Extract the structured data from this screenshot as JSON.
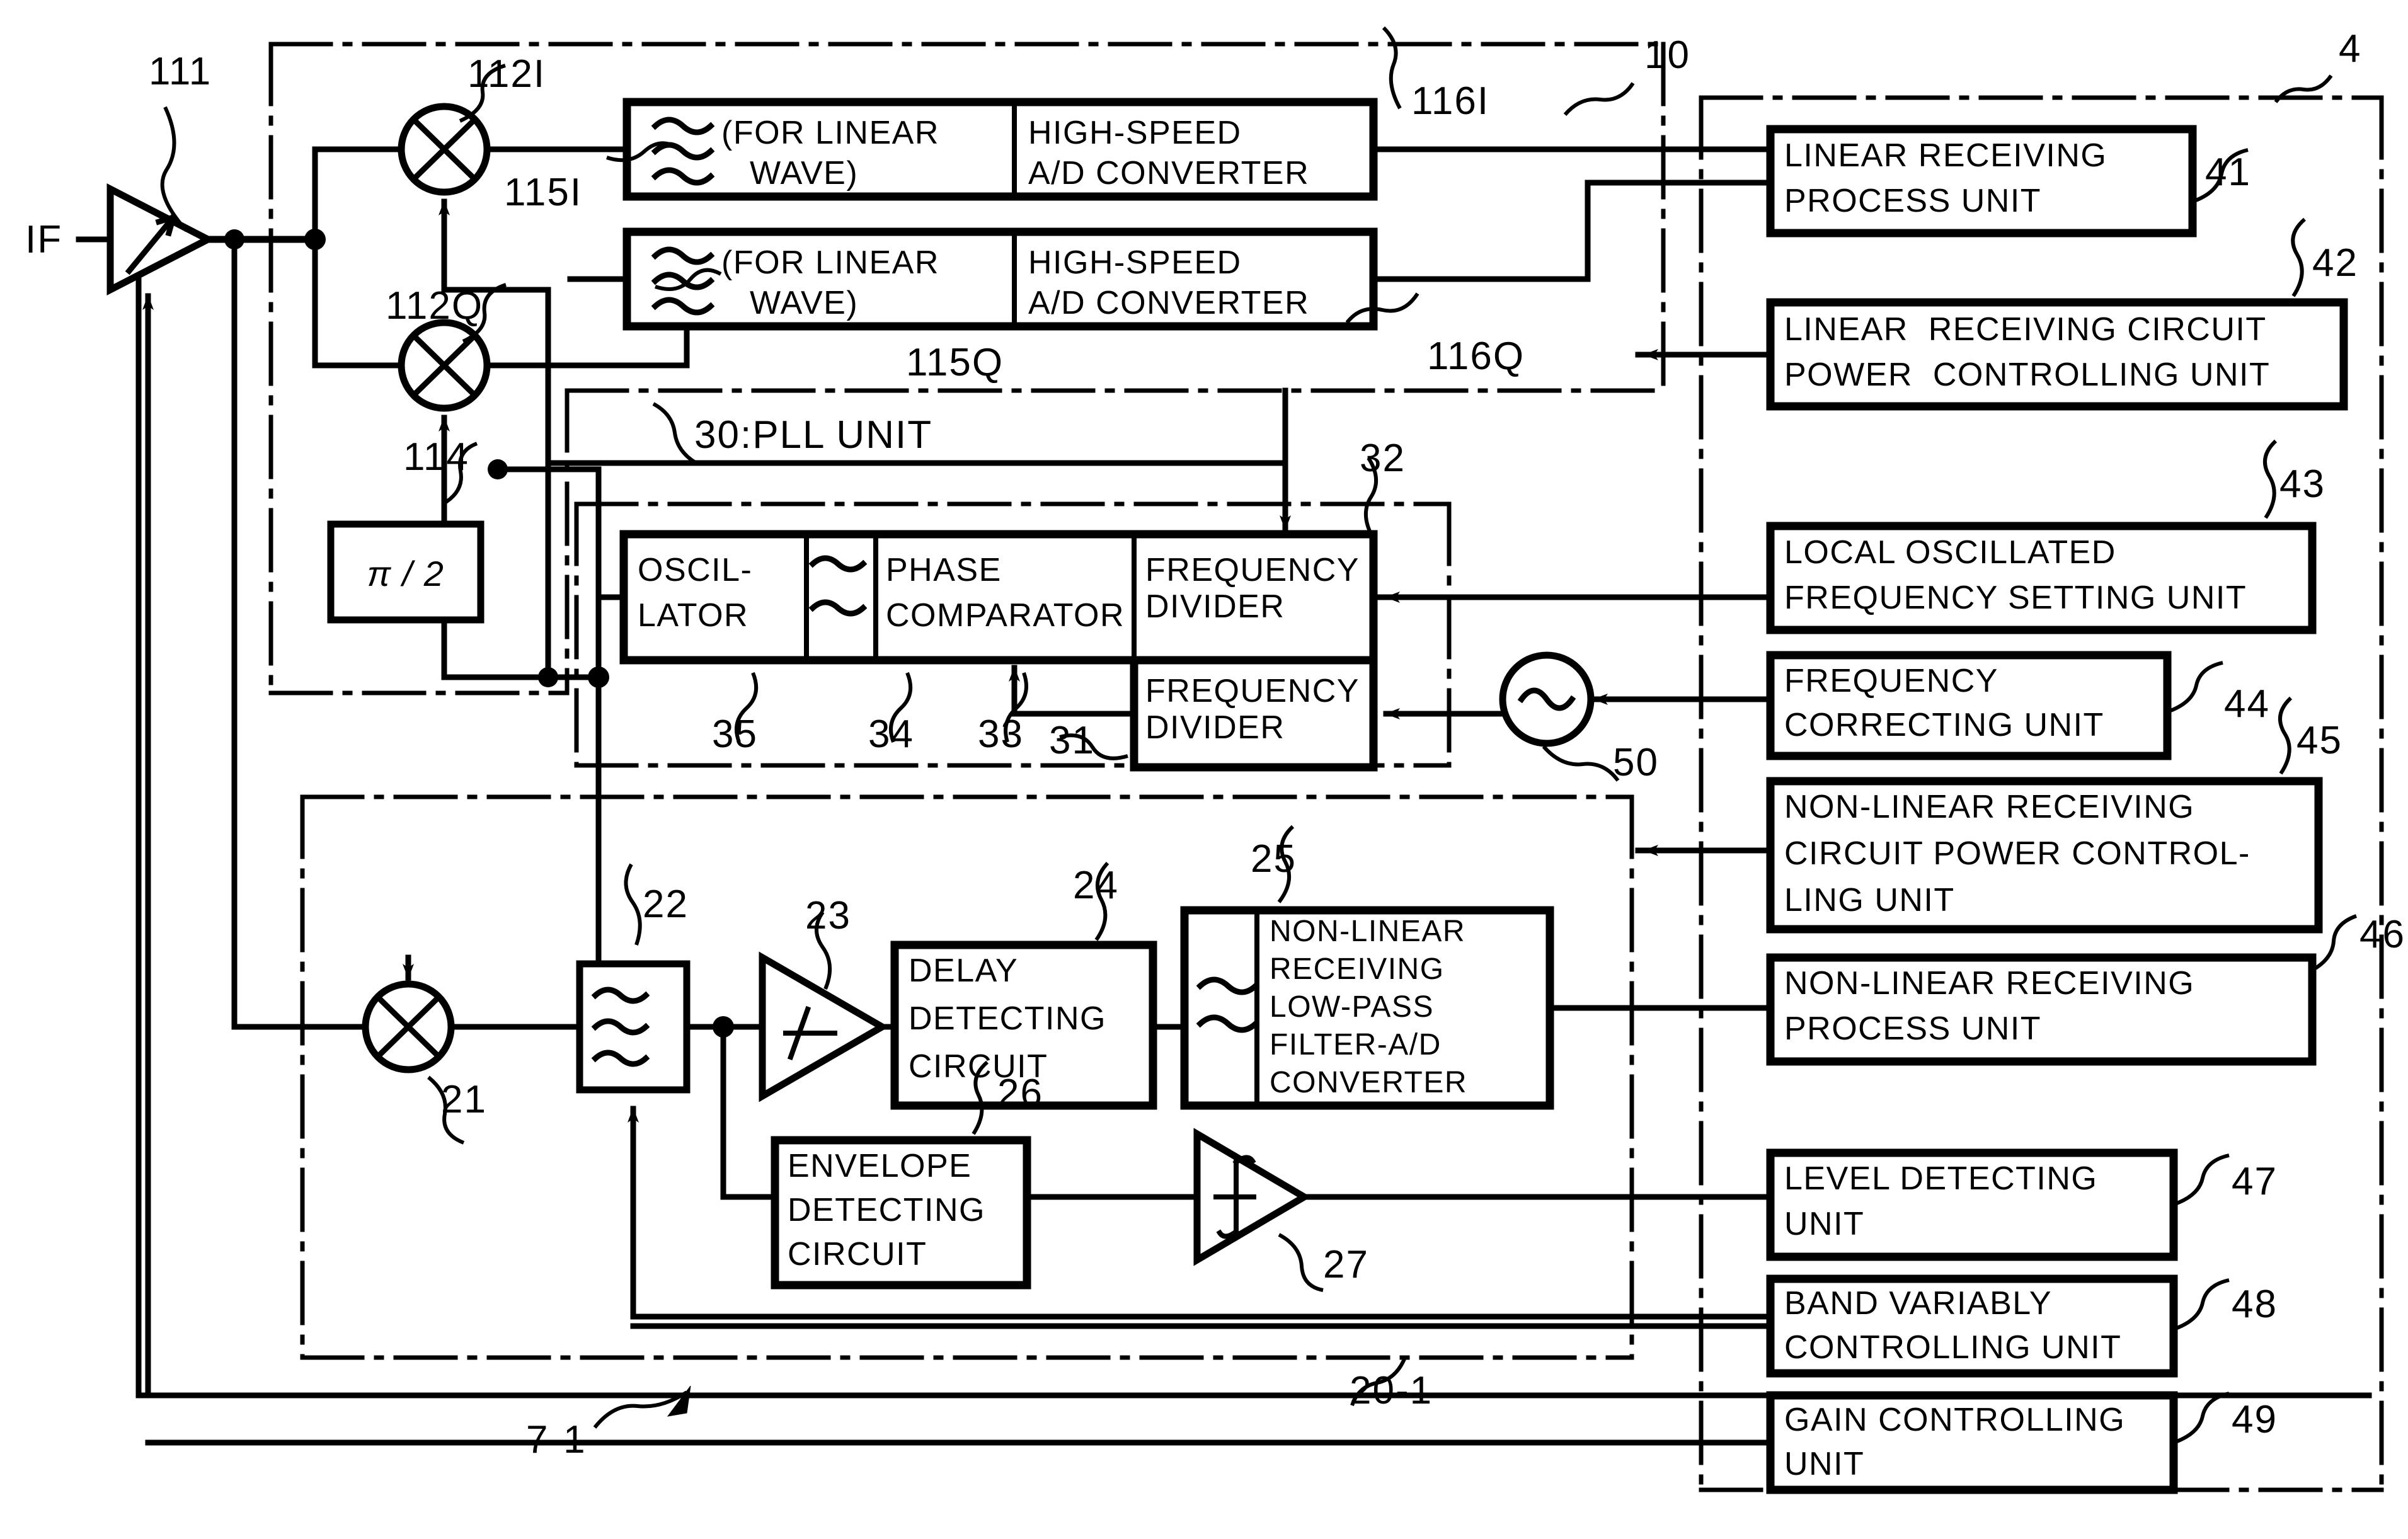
{
  "figure": {
    "type": "patent-block-diagram",
    "input_label": "IF"
  },
  "refs": {
    "r4": "4",
    "r10": "10",
    "r111": "111",
    "r112I": "112I",
    "r112Q": "112Q",
    "r114": "114",
    "r115I": "115I",
    "r115Q": "115Q",
    "r116I": "116I",
    "r116Q": "116Q",
    "r21": "21",
    "r22": "22",
    "r23": "23",
    "r24": "24",
    "r25": "25",
    "r26": "26",
    "r27": "27",
    "r31": "31",
    "r32": "32",
    "r33": "33",
    "r34": "34",
    "r35": "35",
    "r41": "41",
    "r42": "42",
    "r43": "43",
    "r44": "44",
    "r45": "45",
    "r46": "46",
    "r47": "47",
    "r48": "48",
    "r49": "49",
    "r50": "50",
    "r20_1": "20-1",
    "r7_1": "7-1",
    "pll_title": "30:PLL UNIT"
  },
  "blocks": {
    "phase_shifter": "π / 2",
    "linear_i_filter_l1": "(FOR LINEAR",
    "linear_i_filter_l2": "WAVE)",
    "linear_i_adc_l1": "HIGH-SPEED",
    "linear_i_adc_l2": "A/D CONVERTER",
    "linear_q_filter_l1": "(FOR LINEAR",
    "linear_q_filter_l2": "WAVE)",
    "linear_q_adc_l1": "HIGH-SPEED",
    "linear_q_adc_l2": "A/D CONVERTER",
    "oscillator_l1": "OSCIL-",
    "oscillator_l2": "LATOR",
    "phase_comparator_l1": "PHASE",
    "phase_comparator_l2": "COMPARATOR",
    "frequency_divider_top": "FREQUENCY\nDIVIDER",
    "frequency_divider_bottom": "FREQUENCY\nDIVIDER",
    "delay_detecting_l1": "DELAY",
    "delay_detecting_l2": "DETECTING",
    "delay_detecting_l3": "CIRCUIT",
    "nonlinear_lpf_adc_l1": "NON-LINEAR",
    "nonlinear_lpf_adc_l2": "RECEIVING",
    "nonlinear_lpf_adc_l3": "LOW-PASS",
    "nonlinear_lpf_adc_l4": "FILTER-A/D",
    "nonlinear_lpf_adc_l5": "CONVERTER",
    "envelope_detecting_l1": "ENVELOPE",
    "envelope_detecting_l2": "DETECTING",
    "envelope_detecting_l3": "CIRCUIT"
  },
  "units": {
    "u41_l1": "LINEAR RECEIVING",
    "u41_l2": "PROCESS UNIT",
    "u42_l1": "LINEAR  RECEIVING CIRCUIT",
    "u42_l2": "POWER  CONTROLLING UNIT",
    "u43_l1": "LOCAL OSCILLATED",
    "u43_l2": "FREQUENCY SETTING UNIT",
    "u44_l1": "FREQUENCY",
    "u44_l2": "CORRECTING UNIT",
    "u45_l1": "NON-LINEAR RECEIVING",
    "u45_l2": "CIRCUIT POWER CONTROL-",
    "u45_l3": "LING UNIT",
    "u46_l1": "NON-LINEAR RECEIVING",
    "u46_l2": "PROCESS UNIT",
    "u47_l1": "LEVEL DETECTING",
    "u47_l2": "UNIT",
    "u48_l1": "BAND VARIABLY",
    "u48_l2": "CONTROLLING UNIT",
    "u49_l1": "GAIN CONTROLLING",
    "u49_l2": "UNIT"
  },
  "colors": {
    "ink": "#000000",
    "paper": "#ffffff"
  }
}
